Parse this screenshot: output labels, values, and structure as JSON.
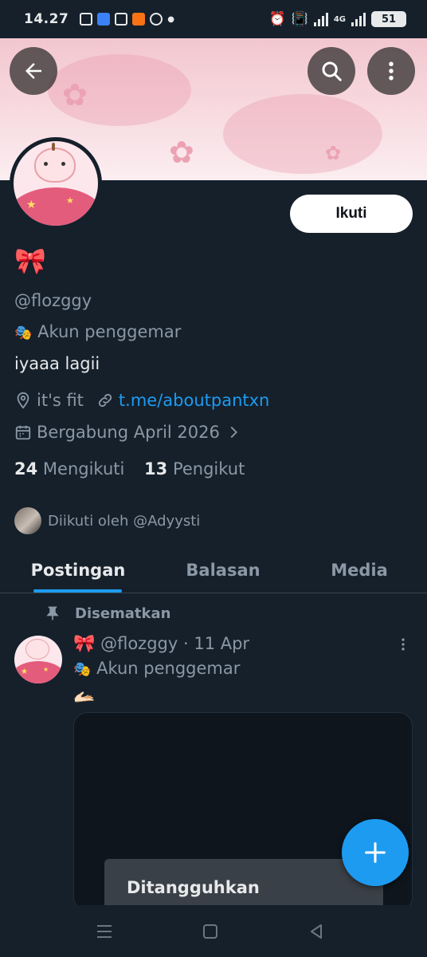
{
  "status_bar": {
    "time": "14.27",
    "network": "4G",
    "battery": "51"
  },
  "header": {
    "back_icon": "arrow-left-icon",
    "search_icon": "search-icon",
    "more_icon": "more-vertical-icon"
  },
  "profile": {
    "display_name": "🎀",
    "handle": "@flozggy",
    "label_emoji": "🎭",
    "label": "Akun penggemar",
    "bio": "iyaaa lagii",
    "location": "it's fit",
    "website": "t.me/aboutpantxn",
    "joined": "Bergabung April 2026",
    "following_count": "24",
    "following_label": "Mengikuti",
    "followers_count": "13",
    "followers_label": "Pengikut",
    "followed_by": "Diikuti oleh @Adyysti",
    "follow_button": "Ikuti"
  },
  "tabs": [
    {
      "label": "Postingan",
      "active": true
    },
    {
      "label": "Balasan",
      "active": false
    },
    {
      "label": "Media",
      "active": false
    }
  ],
  "pinned_post": {
    "pinned_label": "Disematkan",
    "author_emoji": "🎀",
    "author_handle": "@flozggy",
    "separator": "·",
    "date": "11 Apr",
    "author_label_emoji": "🎭",
    "author_label": "Akun penggemar",
    "body": "🫴🏻",
    "suspended_text": "Ditangguhkan"
  },
  "colors": {
    "background": "#15202b",
    "accent": "#1d9bf0",
    "muted": "#8b98a5",
    "text": "#e7e9ea"
  }
}
